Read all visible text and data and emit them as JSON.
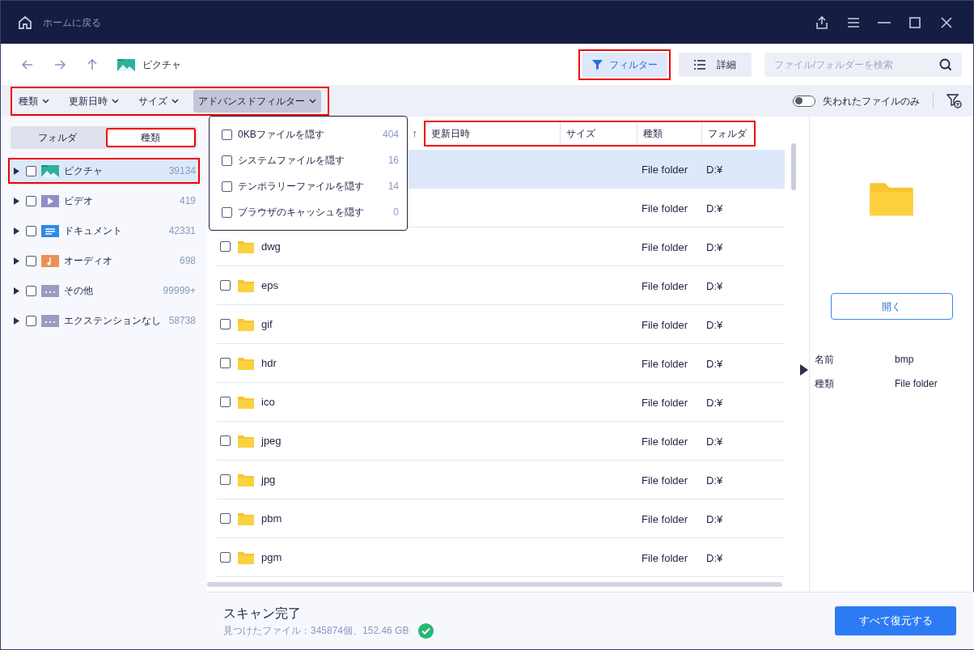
{
  "title_bar": {
    "home_label": "ホームに戻る"
  },
  "toolbar": {
    "location": "ピクチャ",
    "filter_button": {
      "label": "フィルター",
      "selected": true,
      "highlighted": true
    },
    "details_button": {
      "label": "詳細"
    },
    "search": {
      "placeholder": "ファイル/フォルダーを検索"
    }
  },
  "filter_bar": {
    "highlighted": true,
    "filters": [
      {
        "label": "種類",
        "selected": false
      },
      {
        "label": "更新日時",
        "selected": false
      },
      {
        "label": "サイズ",
        "selected": false
      },
      {
        "label": "アドバンスドフィルター",
        "selected": true
      }
    ],
    "lost_only": {
      "label": "失われたファイルのみ",
      "on": false
    }
  },
  "sidebar": {
    "tabs": [
      {
        "label": "フォルダ",
        "selected": false,
        "highlighted": false
      },
      {
        "label": "種類",
        "selected": true,
        "highlighted": true
      }
    ],
    "items": [
      {
        "label": "ピクチャ",
        "count": "39134",
        "kind": "picture",
        "checked": false,
        "selected": true,
        "highlighted": true
      },
      {
        "label": "ビデオ",
        "count": "419",
        "kind": "video",
        "checked": false,
        "selected": false,
        "highlighted": false
      },
      {
        "label": "ドキュメント",
        "count": "42331",
        "kind": "document",
        "checked": false,
        "selected": false,
        "highlighted": false
      },
      {
        "label": "オーディオ",
        "count": "698",
        "kind": "audio",
        "checked": false,
        "selected": false,
        "highlighted": false
      },
      {
        "label": "その他",
        "count": "99999+",
        "kind": "other",
        "checked": false,
        "selected": false,
        "highlighted": false
      },
      {
        "label": "エクステンションなし",
        "count": "58738",
        "kind": "other",
        "checked": false,
        "selected": false,
        "highlighted": false
      }
    ]
  },
  "table": {
    "sort_indicator": "↑",
    "highlighted": true,
    "columns": [
      "更新日時",
      "サイズ",
      "種類",
      "フォルダ"
    ],
    "rows": [
      {
        "type": "File folder",
        "folder": "D:¥",
        "selected": true
      },
      {
        "type": "File folder",
        "folder": "D:¥",
        "selected": false
      },
      {
        "name": "dwg",
        "checked": false,
        "type": "File folder",
        "folder": "D:¥",
        "selected": false
      },
      {
        "name": "eps",
        "checked": false,
        "type": "File folder",
        "folder": "D:¥",
        "selected": false
      },
      {
        "name": "gif",
        "checked": false,
        "type": "File folder",
        "folder": "D:¥",
        "selected": false
      },
      {
        "name": "hdr",
        "checked": false,
        "type": "File folder",
        "folder": "D:¥",
        "selected": false
      },
      {
        "name": "ico",
        "checked": false,
        "type": "File folder",
        "folder": "D:¥",
        "selected": false
      },
      {
        "name": "jpeg",
        "checked": false,
        "type": "File folder",
        "folder": "D:¥",
        "selected": false
      },
      {
        "name": "jpg",
        "checked": false,
        "type": "File folder",
        "folder": "D:¥",
        "selected": false
      },
      {
        "name": "pbm",
        "checked": false,
        "type": "File folder",
        "folder": "D:¥",
        "selected": false
      },
      {
        "name": "pgm",
        "checked": false,
        "type": "File folder",
        "folder": "D:¥",
        "selected": false
      }
    ]
  },
  "advanced_filter_menu": {
    "items": [
      {
        "label": "0KBファイルを隠す",
        "count": "404",
        "checked": false
      },
      {
        "label": "システムファイルを隠す",
        "count": "16",
        "checked": false
      },
      {
        "label": "テンポラリーファイルを隠す",
        "count": "14",
        "checked": false
      },
      {
        "label": "ブラウザのキャッシュを隠す",
        "count": "0",
        "checked": false
      }
    ]
  },
  "preview": {
    "open_button": "開く",
    "properties": [
      {
        "label": "名前",
        "value": "bmp"
      },
      {
        "label": "種類",
        "value": "File folder"
      }
    ]
  },
  "status": {
    "title": "スキャン完了",
    "summary": "見つけたファイル：345874個、152.46 GB",
    "recover_button": "すべて復元する"
  }
}
